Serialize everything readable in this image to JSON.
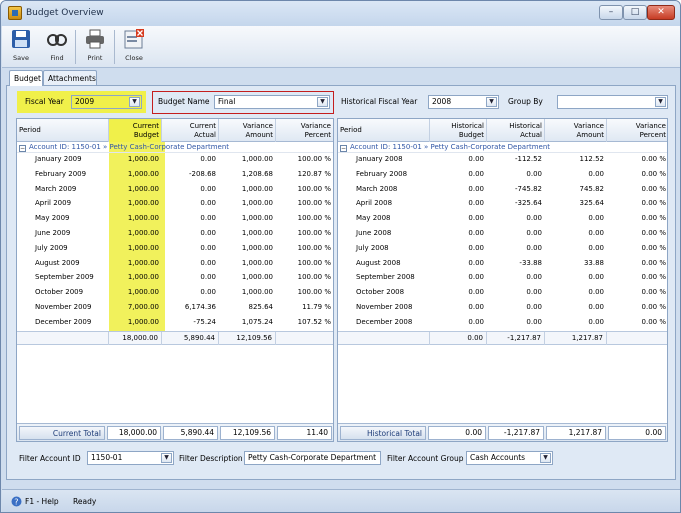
{
  "window": {
    "title": "Budget Overview",
    "minimize": "–",
    "maximize": "□",
    "close": "✕"
  },
  "toolbar": {
    "save": "Save",
    "find": "Find",
    "print": "Print",
    "close": "Close"
  },
  "tabs": [
    "Budget",
    "Attachments"
  ],
  "filters": {
    "fiscal_year_label": "Fiscal Year",
    "fiscal_year": "2009",
    "budget_name_label": "Budget Name",
    "budget_name": "Final",
    "hist_year_label": "Historical Fiscal Year",
    "hist_year": "2008",
    "group_by_label": "Group By",
    "group_by": ""
  },
  "left_grid": {
    "headers": {
      "period": "Period",
      "cb1": "Current",
      "cb2": "Budget",
      "ca1": "Current",
      "ca2": "Actual",
      "va1": "Variance",
      "va2": "Amount",
      "vp1": "Variance",
      "vp2": "Percent"
    },
    "group": "Account ID: 1150-01 » Petty Cash-Corporate Department",
    "rows": [
      [
        "January 2009",
        "1,000.00",
        "0.00",
        "1,000.00",
        "100.00 %"
      ],
      [
        "February 2009",
        "1,000.00",
        "-208.68",
        "1,208.68",
        "120.87 %"
      ],
      [
        "March 2009",
        "1,000.00",
        "0.00",
        "1,000.00",
        "100.00 %"
      ],
      [
        "April 2009",
        "1,000.00",
        "0.00",
        "1,000.00",
        "100.00 %"
      ],
      [
        "May 2009",
        "1,000.00",
        "0.00",
        "1,000.00",
        "100.00 %"
      ],
      [
        "June 2009",
        "1,000.00",
        "0.00",
        "1,000.00",
        "100.00 %"
      ],
      [
        "July 2009",
        "1,000.00",
        "0.00",
        "1,000.00",
        "100.00 %"
      ],
      [
        "August 2009",
        "1,000.00",
        "0.00",
        "1,000.00",
        "100.00 %"
      ],
      [
        "September 2009",
        "1,000.00",
        "0.00",
        "1,000.00",
        "100.00 %"
      ],
      [
        "October 2009",
        "1,000.00",
        "0.00",
        "1,000.00",
        "100.00 %"
      ],
      [
        "November 2009",
        "7,000.00",
        "6,174.36",
        "825.64",
        "11.79 %"
      ],
      [
        "December 2009",
        "1,000.00",
        "-75.24",
        "1,075.24",
        "107.52 %"
      ]
    ],
    "summary": [
      "18,000.00",
      "5,890.44",
      "12,109.56",
      ""
    ],
    "footer_label": "Current Total",
    "footer": [
      "18,000.00",
      "5,890.44",
      "12,109.56",
      "11.40"
    ]
  },
  "right_grid": {
    "headers": {
      "period": "Period",
      "hb1": "Historical",
      "hb2": "Budget",
      "ha1": "Historical",
      "ha2": "Actual",
      "va1": "Variance",
      "va2": "Amount",
      "vp1": "Variance",
      "vp2": "Percent"
    },
    "group": "Account ID: 1150-01 » Petty Cash-Corporate Department",
    "rows": [
      [
        "January 2008",
        "0.00",
        "-112.52",
        "112.52",
        "0.00 %"
      ],
      [
        "February 2008",
        "0.00",
        "0.00",
        "0.00",
        "0.00 %"
      ],
      [
        "March 2008",
        "0.00",
        "-745.82",
        "745.82",
        "0.00 %"
      ],
      [
        "April 2008",
        "0.00",
        "-325.64",
        "325.64",
        "0.00 %"
      ],
      [
        "May 2008",
        "0.00",
        "0.00",
        "0.00",
        "0.00 %"
      ],
      [
        "June 2008",
        "0.00",
        "0.00",
        "0.00",
        "0.00 %"
      ],
      [
        "July 2008",
        "0.00",
        "0.00",
        "0.00",
        "0.00 %"
      ],
      [
        "August 2008",
        "0.00",
        "-33.88",
        "33.88",
        "0.00 %"
      ],
      [
        "September 2008",
        "0.00",
        "0.00",
        "0.00",
        "0.00 %"
      ],
      [
        "October 2008",
        "0.00",
        "0.00",
        "0.00",
        "0.00 %"
      ],
      [
        "November 2008",
        "0.00",
        "0.00",
        "0.00",
        "0.00 %"
      ],
      [
        "December 2008",
        "0.00",
        "0.00",
        "0.00",
        "0.00 %"
      ]
    ],
    "summary": [
      "0.00",
      "-1,217.87",
      "1,217.87",
      ""
    ],
    "footer_label": "Historical Total",
    "footer": [
      "0.00",
      "-1,217.87",
      "1,217.87",
      "0.00"
    ]
  },
  "bottom": {
    "account_label": "Filter Account ID",
    "account": "1150-01",
    "desc_label": "Filter Description",
    "desc": "Petty Cash-Corporate Department",
    "group_label": "Filter Account Group",
    "group": "Cash Accounts"
  },
  "status": {
    "help": "F1 - Help",
    "state": "Ready"
  },
  "colors": {
    "highlight": "#f0f04a",
    "red_box": "#c41e1e",
    "group_text": "#3157a6"
  }
}
